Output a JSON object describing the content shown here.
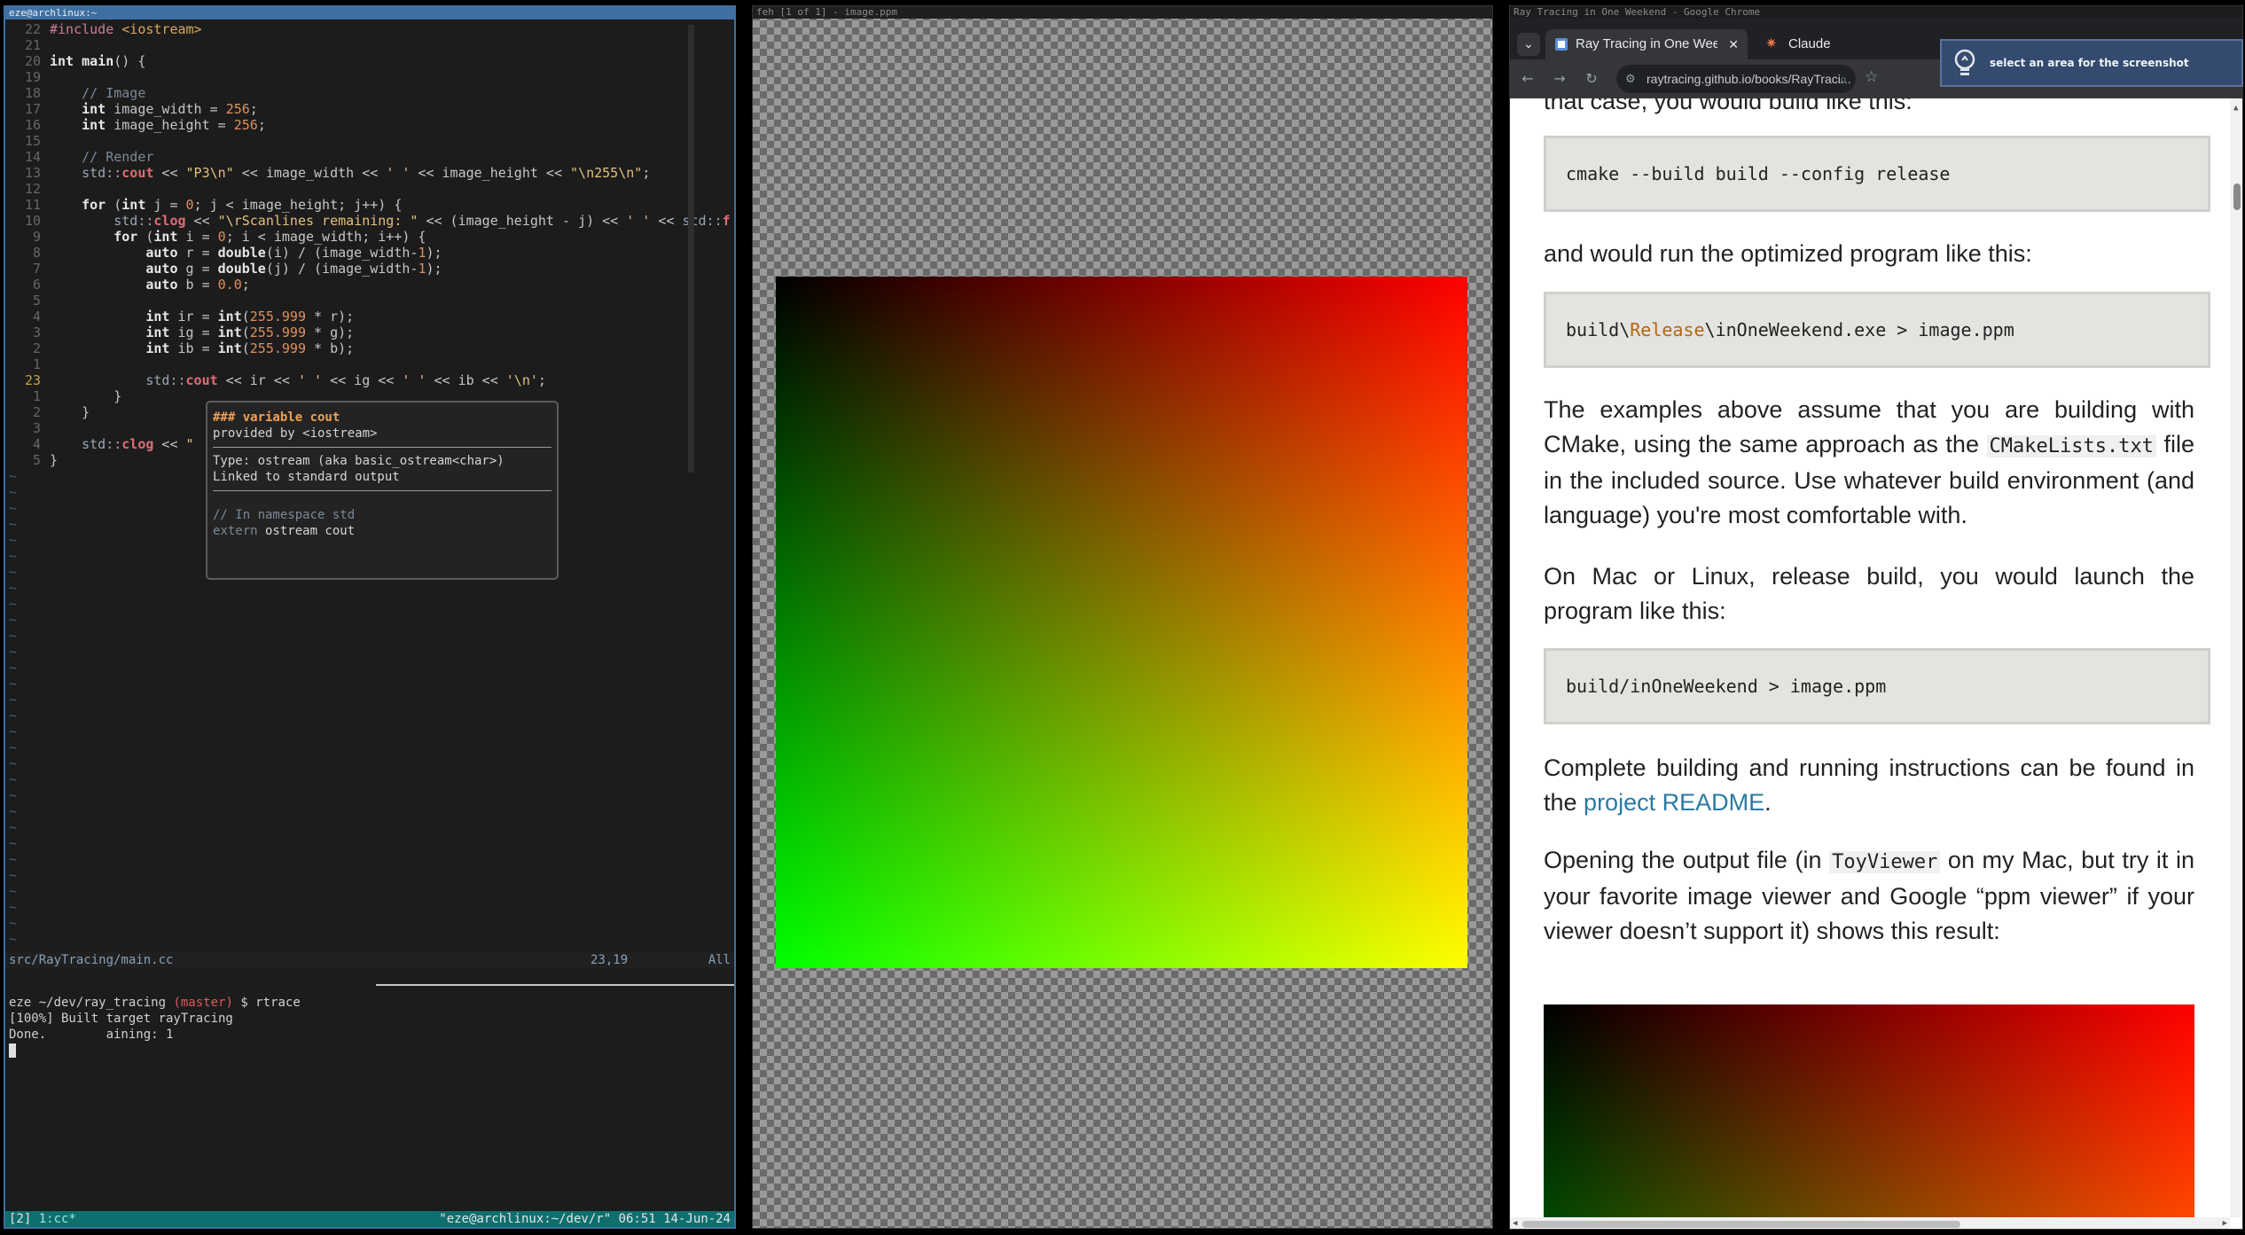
{
  "terminal": {
    "title": "eze@archlinux:~",
    "code_lines": [
      {
        "n": "22",
        "html": "<span class=\"pp\">#include</span> <span class=\"inc\">&lt;iostream&gt;</span>"
      },
      {
        "n": "21",
        "html": ""
      },
      {
        "n": "20",
        "html": "<span class=\"typ\">int</span> <span class=\"kw\">main</span>() {"
      },
      {
        "n": "19",
        "html": ""
      },
      {
        "n": "18",
        "html": "    <span class=\"com\">// Image</span>"
      },
      {
        "n": "17",
        "html": "    <span class=\"typ\">int</span> image_width = <span class=\"num\">256</span>;"
      },
      {
        "n": "16",
        "html": "    <span class=\"typ\">int</span> image_height = <span class=\"num\">256</span>;"
      },
      {
        "n": "15",
        "html": ""
      },
      {
        "n": "14",
        "html": "    <span class=\"com\">// Render</span>"
      },
      {
        "n": "13",
        "html": "    <span class=\"ns\">std::</span><span class=\"fn\">cout</span> &lt;&lt; <span class=\"str\">\"P3\\n\"</span> &lt;&lt; image_width &lt;&lt; <span class=\"str\">' '</span> &lt;&lt; image_height &lt;&lt; <span class=\"str\">\"\\n255\\n\"</span>;"
      },
      {
        "n": "12",
        "html": ""
      },
      {
        "n": "11",
        "html": "    <span class=\"typ\">for</span> (<span class=\"typ\">int</span> j = <span class=\"num\">0</span>; j &lt; image_height; j++) {"
      },
      {
        "n": "10",
        "html": "        <span class=\"ns\">std::</span><span class=\"fn\">clog</span> &lt;&lt; <span class=\"str\">\"\\rScanlines remaining: \"</span> &lt;&lt; (image_height - j) &lt;&lt; <span class=\"str\">' '</span> &lt;&lt; <span class=\"ns\">std::</span><span class=\"fn\">f</span>"
      },
      {
        "n": "9",
        "html": "        <span class=\"typ\">for</span> (<span class=\"typ\">int</span> i = <span class=\"num\">0</span>; i &lt; image_width; i++) {"
      },
      {
        "n": "8",
        "html": "            <span class=\"typ\">auto</span> r = <span class=\"typ\">double</span>(i) / (image_width-<span class=\"num\">1</span>);"
      },
      {
        "n": "7",
        "html": "            <span class=\"typ\">auto</span> g = <span class=\"typ\">double</span>(j) / (image_width-<span class=\"num\">1</span>);"
      },
      {
        "n": "6",
        "html": "            <span class=\"typ\">auto</span> b = <span class=\"num\">0.0</span>;"
      },
      {
        "n": "5",
        "html": ""
      },
      {
        "n": "4",
        "html": "            <span class=\"typ\">int</span> ir = <span class=\"typ\">int</span>(<span class=\"num\">255.999</span> * r);"
      },
      {
        "n": "3",
        "html": "            <span class=\"typ\">int</span> ig = <span class=\"typ\">int</span>(<span class=\"num\">255.999</span> * g);"
      },
      {
        "n": "2",
        "html": "            <span class=\"typ\">int</span> ib = <span class=\"typ\">int</span>(<span class=\"num\">255.999</span> * b);"
      },
      {
        "n": "1",
        "html": ""
      },
      {
        "n": "23",
        "html": "            <span class=\"ns\">std::</span><span class=\"fn\">cout</span> &lt;&lt; ir &lt;&lt; <span class=\"str\">' '</span> &lt;&lt; ig &lt;&lt; <span class=\"str\">' '</span> &lt;&lt; ib &lt;&lt; <span class=\"str\">'\\n'</span>;",
        "current": true
      },
      {
        "n": "1",
        "html": "        }"
      },
      {
        "n": "2",
        "html": "    }"
      },
      {
        "n": "3",
        "html": ""
      },
      {
        "n": "4",
        "html": "    <span class=\"ns\">std::</span><span class=\"fn\">clog</span> &lt;&lt; <span class=\"str\">\"</span>"
      },
      {
        "n": "5",
        "html": "}"
      }
    ],
    "tilde_count": 30,
    "hover": {
      "heading": "### variable cout",
      "provided": "provided by <iostream>",
      "type_line": "Type: ostream (aka basic_ostream<char>)",
      "desc": "Linked to standard output",
      "ns_comment": "// In namespace std",
      "decl_kw": "extern",
      "decl_rest": " ostream cout"
    },
    "status": {
      "file": "src/RayTracing/main.cc",
      "pos": "23,19",
      "scroll": "All"
    },
    "shell": {
      "user_path": "eze ~/dev/ray_tracing",
      "branch": "(master)",
      "prompt_cmd": " $ rtrace",
      "line2": "[100%] Built target rayTracing",
      "line3": "Done.        aining: 1"
    },
    "tmux": {
      "left_index": "[2] ",
      "left_window": "1:cc*",
      "right": "\"eze@archlinux:~/dev/r\" 06:51 14-Jun-24"
    }
  },
  "feh": {
    "title": "feh [1 of 1] - image.ppm"
  },
  "chrome": {
    "title": "Ray Tracing in One Weekend - Google Chrome",
    "tab1": "Ray Tracing in One Weekend",
    "tab2": "Claude",
    "url": "raytracing.github.io/books/RayTraci...",
    "content": {
      "p1": "that case, you would build like this:",
      "code1": "cmake --build build --config release",
      "p2": "and would run the optimized program like this:",
      "code2_a": "build\\",
      "code2_b": "Release",
      "code2_c": "\\inOneWeekend.exe > image.ppm",
      "p3_a": "The examples above assume that you are building with CMake, using the same approach as the ",
      "p3_code": "CMakeLists.txt",
      "p3_b": " file in the included source. Use whatever build environment (and language) you're most comfortable with.",
      "p4": "On Mac or Linux, release build, you would launch the program like this:",
      "code3": "build/inOneWeekend > image.ppm",
      "p5_a": "Complete building and running instructions can be found in the ",
      "p5_link": "project README",
      "p5_b": ".",
      "p6_a": "Opening the output file (in ",
      "p6_code": "ToyViewer",
      "p6_b": " on my Mac, but try it in your favorite image viewer and Google “ppm viewer” if your viewer doesn’t support it) shows this result:"
    }
  },
  "toast": {
    "message": "select an area for the screenshot",
    "icon": "lightbulb-icon"
  }
}
